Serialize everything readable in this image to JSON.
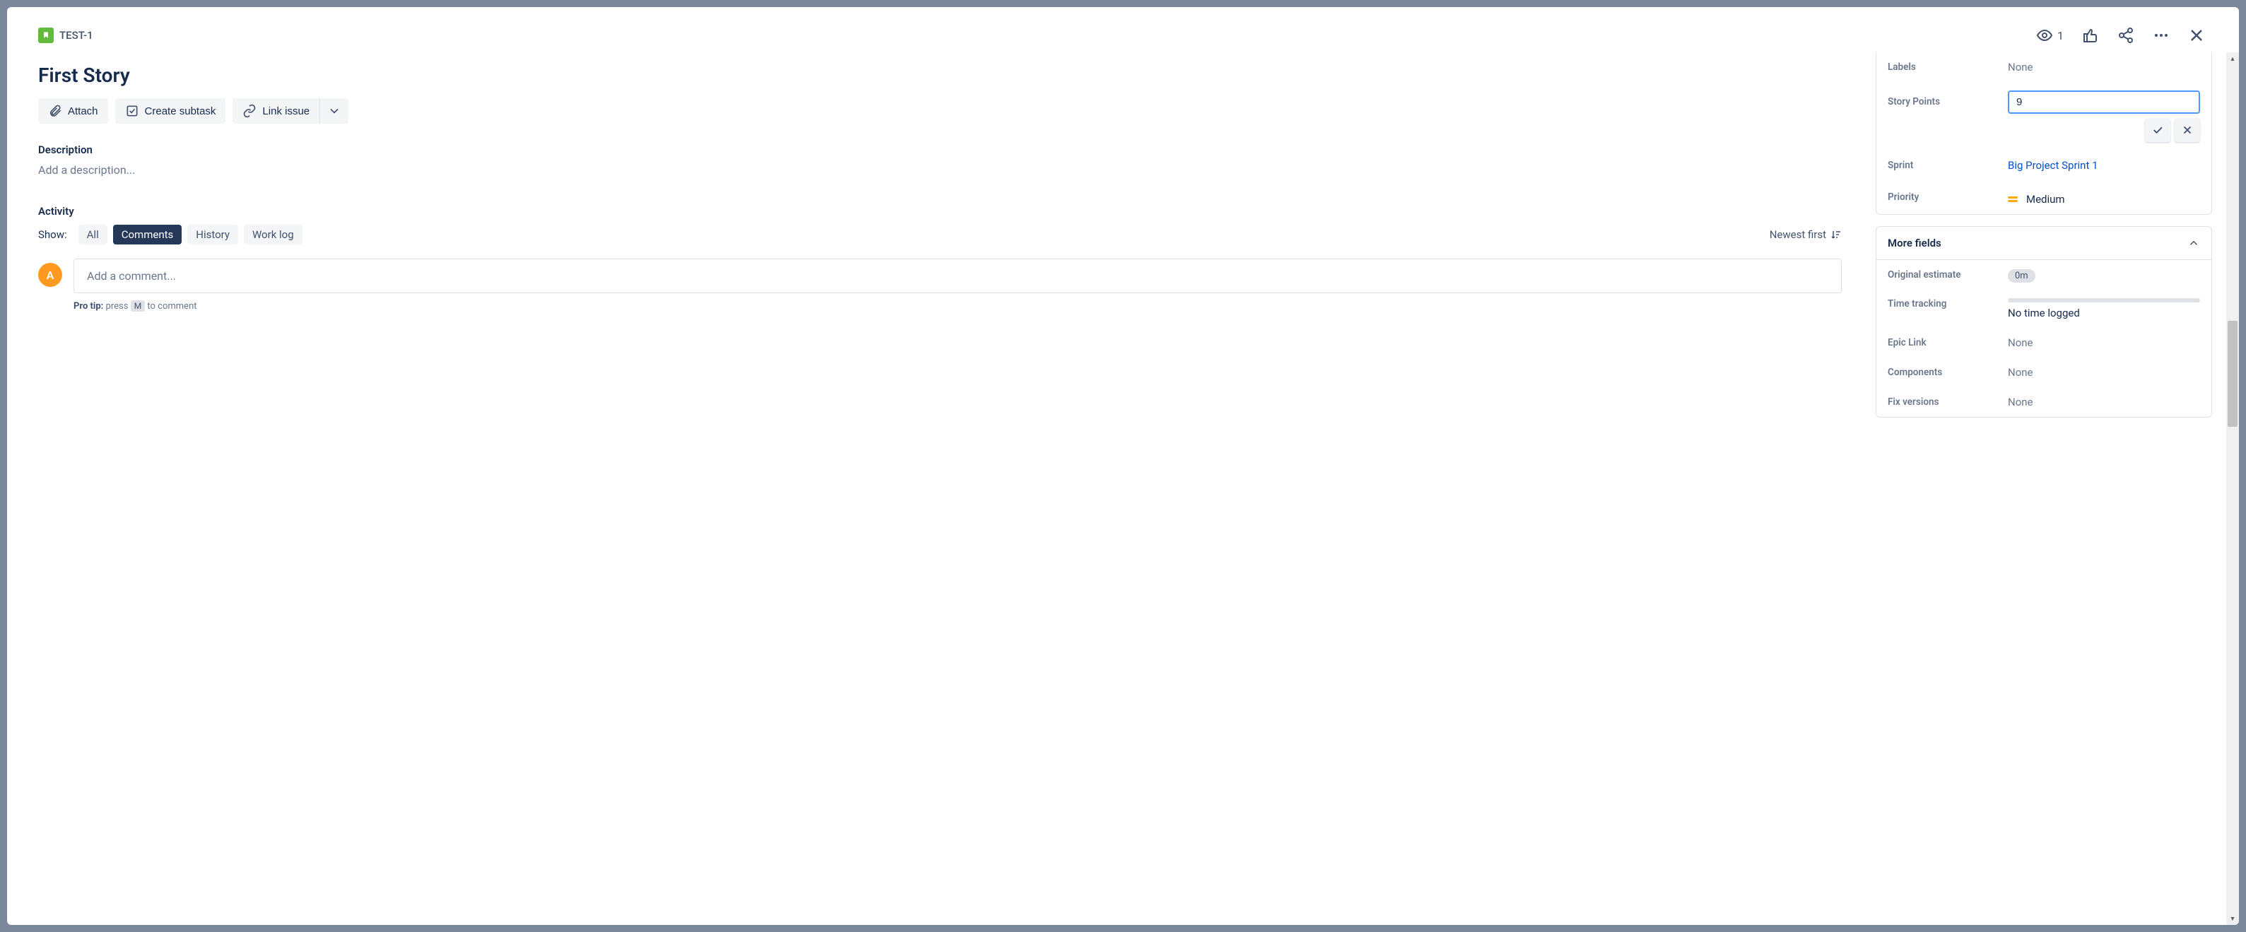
{
  "breadcrumb": {
    "issue_key": "TEST-1"
  },
  "header": {
    "watch_count": "1"
  },
  "issue": {
    "title": "First Story"
  },
  "actions": {
    "attach": "Attach",
    "create_subtask": "Create subtask",
    "link_issue": "Link issue"
  },
  "description": {
    "heading": "Description",
    "placeholder": "Add a description..."
  },
  "activity": {
    "heading": "Activity",
    "show_label": "Show:",
    "tabs": {
      "all": "All",
      "comments": "Comments",
      "history": "History",
      "worklog": "Work log"
    },
    "sort": "Newest first"
  },
  "comment": {
    "avatar_initial": "A",
    "placeholder": "Add a comment...",
    "protip_label": "Pro tip:",
    "protip_press": " press ",
    "protip_key": "M",
    "protip_rest": " to comment"
  },
  "details": {
    "labels": {
      "label": "Labels",
      "value": "None"
    },
    "story_points": {
      "label": "Story Points",
      "value": "9"
    },
    "sprint": {
      "label": "Sprint",
      "value": "Big Project Sprint 1"
    },
    "priority": {
      "label": "Priority",
      "value": "Medium"
    }
  },
  "more_fields": {
    "heading": "More fields",
    "original_estimate": {
      "label": "Original estimate",
      "value": "0m"
    },
    "time_tracking": {
      "label": "Time tracking",
      "value": "No time logged"
    },
    "epic_link": {
      "label": "Epic Link",
      "value": "None"
    },
    "components": {
      "label": "Components",
      "value": "None"
    },
    "fix_versions": {
      "label": "Fix versions",
      "value": "None"
    }
  }
}
